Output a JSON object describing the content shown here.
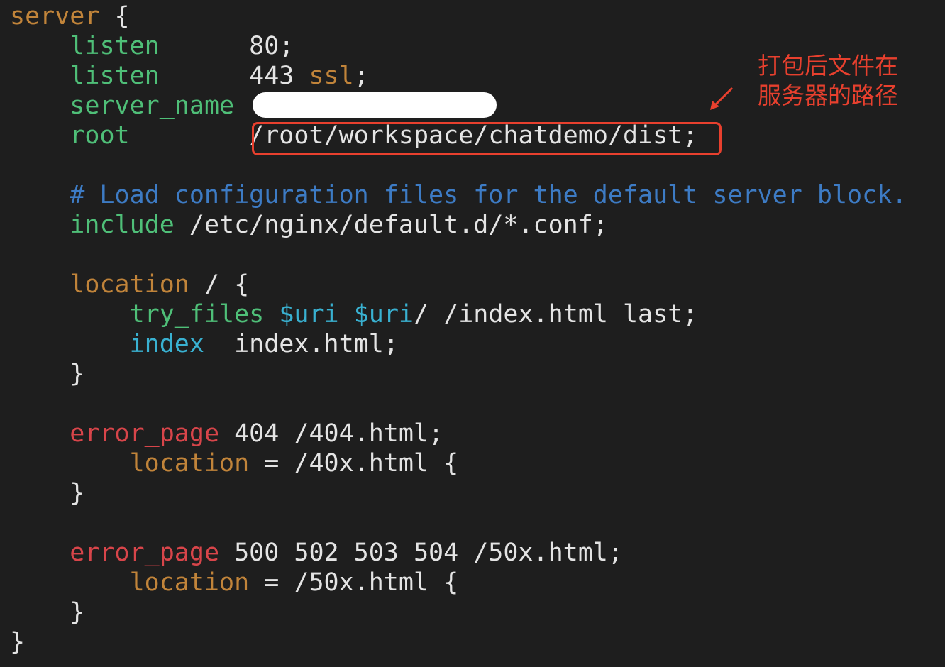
{
  "colors": {
    "background": "#1e1e1e",
    "default": "#e4e4e4",
    "block_keyword": "#c1843a",
    "directive": "#4fbf78",
    "comment": "#3d7bc4",
    "variable": "#39b1d1",
    "error_directive": "#d8454a",
    "ssl_keyword": "#c1843a",
    "annotation": "#e8402e"
  },
  "annotation": {
    "line1": "打包后文件在",
    "line2": "服务器的路径"
  },
  "lines": [
    [
      {
        "t": "server",
        "c": "block_keyword"
      },
      {
        "t": " {",
        "c": "default"
      }
    ],
    [
      {
        "t": "    ",
        "c": "default"
      },
      {
        "t": "listen",
        "c": "directive"
      },
      {
        "t": "      80;",
        "c": "default"
      }
    ],
    [
      {
        "t": "    ",
        "c": "default"
      },
      {
        "t": "listen",
        "c": "directive"
      },
      {
        "t": "      443 ",
        "c": "default"
      },
      {
        "t": "ssl",
        "c": "ssl_keyword"
      },
      {
        "t": ";",
        "c": "default"
      }
    ],
    [
      {
        "t": "    ",
        "c": "default"
      },
      {
        "t": "server_name",
        "c": "directive"
      }
    ],
    [
      {
        "t": "    ",
        "c": "default"
      },
      {
        "t": "root",
        "c": "directive"
      },
      {
        "t": "        /root/workspace/chatdemo/dist;",
        "c": "default"
      }
    ],
    [],
    [
      {
        "t": "    # Load configuration files for the default server block.",
        "c": "comment"
      }
    ],
    [
      {
        "t": "    ",
        "c": "default"
      },
      {
        "t": "include",
        "c": "directive"
      },
      {
        "t": " /etc/nginx/default.d/*.conf;",
        "c": "default"
      }
    ],
    [],
    [
      {
        "t": "    ",
        "c": "default"
      },
      {
        "t": "location",
        "c": "block_keyword"
      },
      {
        "t": " / {",
        "c": "default"
      }
    ],
    [
      {
        "t": "        ",
        "c": "default"
      },
      {
        "t": "try_files",
        "c": "directive"
      },
      {
        "t": " ",
        "c": "default"
      },
      {
        "t": "$uri",
        "c": "variable"
      },
      {
        "t": " ",
        "c": "default"
      },
      {
        "t": "$uri",
        "c": "variable"
      },
      {
        "t": "/ /index.html last;",
        "c": "default"
      }
    ],
    [
      {
        "t": "        ",
        "c": "default"
      },
      {
        "t": "index",
        "c": "variable"
      },
      {
        "t": "  index.html;",
        "c": "default"
      }
    ],
    [
      {
        "t": "    }",
        "c": "default"
      }
    ],
    [],
    [
      {
        "t": "    ",
        "c": "default"
      },
      {
        "t": "error_page",
        "c": "error_directive"
      },
      {
        "t": " 404 /404.html;",
        "c": "default"
      }
    ],
    [
      {
        "t": "        ",
        "c": "default"
      },
      {
        "t": "location",
        "c": "block_keyword"
      },
      {
        "t": " = /40x.html {",
        "c": "default"
      }
    ],
    [
      {
        "t": "    }",
        "c": "default"
      }
    ],
    [],
    [
      {
        "t": "    ",
        "c": "default"
      },
      {
        "t": "error_page",
        "c": "error_directive"
      },
      {
        "t": " 500 502 503 504 /50x.html;",
        "c": "default"
      }
    ],
    [
      {
        "t": "        ",
        "c": "default"
      },
      {
        "t": "location",
        "c": "block_keyword"
      },
      {
        "t": " = /50x.html {",
        "c": "default"
      }
    ],
    [
      {
        "t": "    }",
        "c": "default"
      }
    ],
    [
      {
        "t": "}",
        "c": "default"
      }
    ]
  ]
}
